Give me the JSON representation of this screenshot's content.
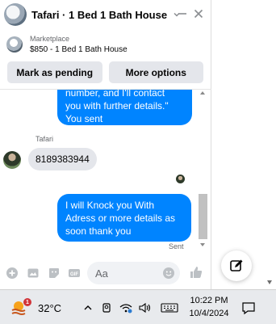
{
  "header": {
    "title": "Tafari · 1 Bed 1 Bath House"
  },
  "marketplace": {
    "label": "Marketplace",
    "listing": "$850 - 1 Bed 1 Bath House"
  },
  "actions": {
    "mark_pending": "Mark as pending",
    "more_options": "More options"
  },
  "messages": {
    "outgoing_1_lines": [
      "number, and I'll contact",
      "you with further details.\"",
      "You sent"
    ],
    "sender_name": "Tafari",
    "incoming_1": "8189383944",
    "outgoing_2_lines": [
      "I will Knock you With",
      "Adress or more details  as",
      "soon thank you"
    ],
    "status": "Sent"
  },
  "composer": {
    "placeholder": "Aa"
  },
  "taskbar": {
    "temperature": "32°C",
    "weather_badge": "1",
    "time": "10:22 PM",
    "date": "10/4/2024"
  },
  "colors": {
    "outgoing_bubble": "#0084ff",
    "incoming_bubble": "#e4e6eb",
    "taskbar": "#e8eaed"
  }
}
